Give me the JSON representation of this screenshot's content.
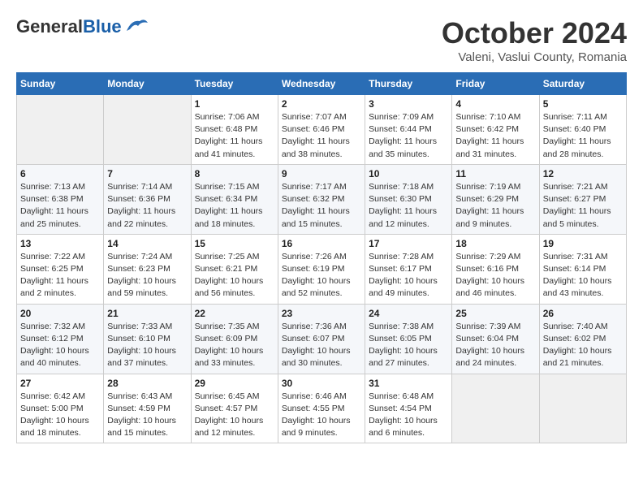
{
  "header": {
    "logo_general": "General",
    "logo_blue": "Blue",
    "month_title": "October 2024",
    "location": "Valeni, Vaslui County, Romania"
  },
  "weekdays": [
    "Sunday",
    "Monday",
    "Tuesday",
    "Wednesday",
    "Thursday",
    "Friday",
    "Saturday"
  ],
  "weeks": [
    [
      {
        "day": "",
        "info": ""
      },
      {
        "day": "",
        "info": ""
      },
      {
        "day": "1",
        "info": "Sunrise: 7:06 AM\nSunset: 6:48 PM\nDaylight: 11 hours and 41 minutes."
      },
      {
        "day": "2",
        "info": "Sunrise: 7:07 AM\nSunset: 6:46 PM\nDaylight: 11 hours and 38 minutes."
      },
      {
        "day": "3",
        "info": "Sunrise: 7:09 AM\nSunset: 6:44 PM\nDaylight: 11 hours and 35 minutes."
      },
      {
        "day": "4",
        "info": "Sunrise: 7:10 AM\nSunset: 6:42 PM\nDaylight: 11 hours and 31 minutes."
      },
      {
        "day": "5",
        "info": "Sunrise: 7:11 AM\nSunset: 6:40 PM\nDaylight: 11 hours and 28 minutes."
      }
    ],
    [
      {
        "day": "6",
        "info": "Sunrise: 7:13 AM\nSunset: 6:38 PM\nDaylight: 11 hours and 25 minutes."
      },
      {
        "day": "7",
        "info": "Sunrise: 7:14 AM\nSunset: 6:36 PM\nDaylight: 11 hours and 22 minutes."
      },
      {
        "day": "8",
        "info": "Sunrise: 7:15 AM\nSunset: 6:34 PM\nDaylight: 11 hours and 18 minutes."
      },
      {
        "day": "9",
        "info": "Sunrise: 7:17 AM\nSunset: 6:32 PM\nDaylight: 11 hours and 15 minutes."
      },
      {
        "day": "10",
        "info": "Sunrise: 7:18 AM\nSunset: 6:30 PM\nDaylight: 11 hours and 12 minutes."
      },
      {
        "day": "11",
        "info": "Sunrise: 7:19 AM\nSunset: 6:29 PM\nDaylight: 11 hours and 9 minutes."
      },
      {
        "day": "12",
        "info": "Sunrise: 7:21 AM\nSunset: 6:27 PM\nDaylight: 11 hours and 5 minutes."
      }
    ],
    [
      {
        "day": "13",
        "info": "Sunrise: 7:22 AM\nSunset: 6:25 PM\nDaylight: 11 hours and 2 minutes."
      },
      {
        "day": "14",
        "info": "Sunrise: 7:24 AM\nSunset: 6:23 PM\nDaylight: 10 hours and 59 minutes."
      },
      {
        "day": "15",
        "info": "Sunrise: 7:25 AM\nSunset: 6:21 PM\nDaylight: 10 hours and 56 minutes."
      },
      {
        "day": "16",
        "info": "Sunrise: 7:26 AM\nSunset: 6:19 PM\nDaylight: 10 hours and 52 minutes."
      },
      {
        "day": "17",
        "info": "Sunrise: 7:28 AM\nSunset: 6:17 PM\nDaylight: 10 hours and 49 minutes."
      },
      {
        "day": "18",
        "info": "Sunrise: 7:29 AM\nSunset: 6:16 PM\nDaylight: 10 hours and 46 minutes."
      },
      {
        "day": "19",
        "info": "Sunrise: 7:31 AM\nSunset: 6:14 PM\nDaylight: 10 hours and 43 minutes."
      }
    ],
    [
      {
        "day": "20",
        "info": "Sunrise: 7:32 AM\nSunset: 6:12 PM\nDaylight: 10 hours and 40 minutes."
      },
      {
        "day": "21",
        "info": "Sunrise: 7:33 AM\nSunset: 6:10 PM\nDaylight: 10 hours and 37 minutes."
      },
      {
        "day": "22",
        "info": "Sunrise: 7:35 AM\nSunset: 6:09 PM\nDaylight: 10 hours and 33 minutes."
      },
      {
        "day": "23",
        "info": "Sunrise: 7:36 AM\nSunset: 6:07 PM\nDaylight: 10 hours and 30 minutes."
      },
      {
        "day": "24",
        "info": "Sunrise: 7:38 AM\nSunset: 6:05 PM\nDaylight: 10 hours and 27 minutes."
      },
      {
        "day": "25",
        "info": "Sunrise: 7:39 AM\nSunset: 6:04 PM\nDaylight: 10 hours and 24 minutes."
      },
      {
        "day": "26",
        "info": "Sunrise: 7:40 AM\nSunset: 6:02 PM\nDaylight: 10 hours and 21 minutes."
      }
    ],
    [
      {
        "day": "27",
        "info": "Sunrise: 6:42 AM\nSunset: 5:00 PM\nDaylight: 10 hours and 18 minutes."
      },
      {
        "day": "28",
        "info": "Sunrise: 6:43 AM\nSunset: 4:59 PM\nDaylight: 10 hours and 15 minutes."
      },
      {
        "day": "29",
        "info": "Sunrise: 6:45 AM\nSunset: 4:57 PM\nDaylight: 10 hours and 12 minutes."
      },
      {
        "day": "30",
        "info": "Sunrise: 6:46 AM\nSunset: 4:55 PM\nDaylight: 10 hours and 9 minutes."
      },
      {
        "day": "31",
        "info": "Sunrise: 6:48 AM\nSunset: 4:54 PM\nDaylight: 10 hours and 6 minutes."
      },
      {
        "day": "",
        "info": ""
      },
      {
        "day": "",
        "info": ""
      }
    ]
  ]
}
